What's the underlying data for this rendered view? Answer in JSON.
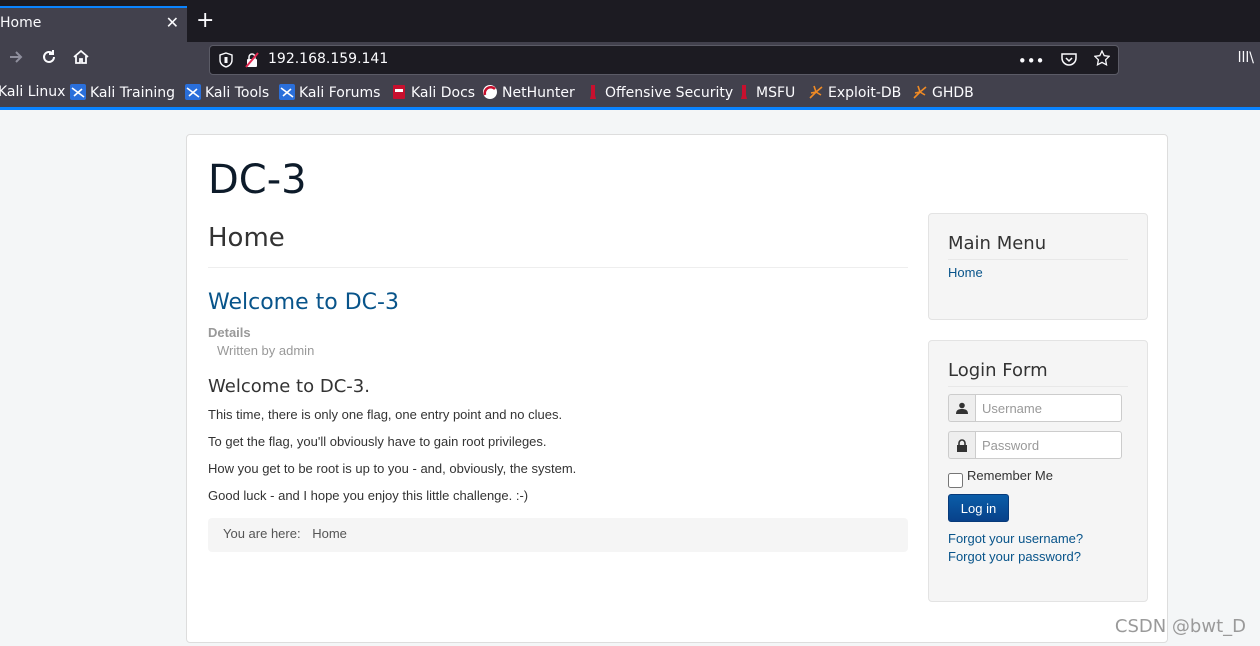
{
  "browser": {
    "tab_title": "Home",
    "tab_close": "✕",
    "new_tab": "+",
    "url": "192.168.159.141",
    "library": "lll\\",
    "bookmarks": [
      {
        "label": "Kali Linux",
        "icon": "kali-icon"
      },
      {
        "label": "Kali Training",
        "icon": "kali-icon"
      },
      {
        "label": "Kali Tools",
        "icon": "kali-icon"
      },
      {
        "label": "Kali Forums",
        "icon": "kali-icon"
      },
      {
        "label": "Kali Docs",
        "icon": "kali-docs-icon"
      },
      {
        "label": "NetHunter",
        "icon": "nethunter-icon"
      },
      {
        "label": "Offensive Security",
        "icon": "offsec-icon"
      },
      {
        "label": "MSFU",
        "icon": "offsec-icon"
      },
      {
        "label": "Exploit-DB",
        "icon": "exploitdb-icon"
      },
      {
        "label": "GHDB",
        "icon": "exploitdb-icon"
      }
    ]
  },
  "site": {
    "title": "DC-3"
  },
  "main": {
    "page_header": "Home",
    "article_title": "Welcome to DC-3",
    "details_label": "Details",
    "written_by": "Written by admin",
    "heading": "Welcome to DC-3.",
    "paragraphs": [
      "This time, there is only one flag, one entry point and no clues.",
      "To get the flag, you'll obviously have to gain root privileges.",
      "How you get to be root is up to you - and, obviously, the system.",
      "Good luck - and I hope you enjoy this little challenge.  :-)"
    ],
    "breadcrumb_prefix": "You are here:",
    "breadcrumb_home": "Home"
  },
  "sidebar": {
    "menu_title": "Main Menu",
    "menu_items": [
      "Home"
    ],
    "login_title": "Login Form",
    "username_placeholder": "Username",
    "password_placeholder": "Password",
    "remember_label": "Remember Me",
    "login_button": "Log in",
    "forgot_username": "Forgot your username?",
    "forgot_password": "Forgot your password?"
  },
  "watermark": "CSDN @bwt_D",
  "colors": {
    "chrome_dark": "#1c1b22",
    "chrome": "#42414d",
    "accent": "#0a84ff",
    "link": "#08548a",
    "button": "#08418a"
  }
}
